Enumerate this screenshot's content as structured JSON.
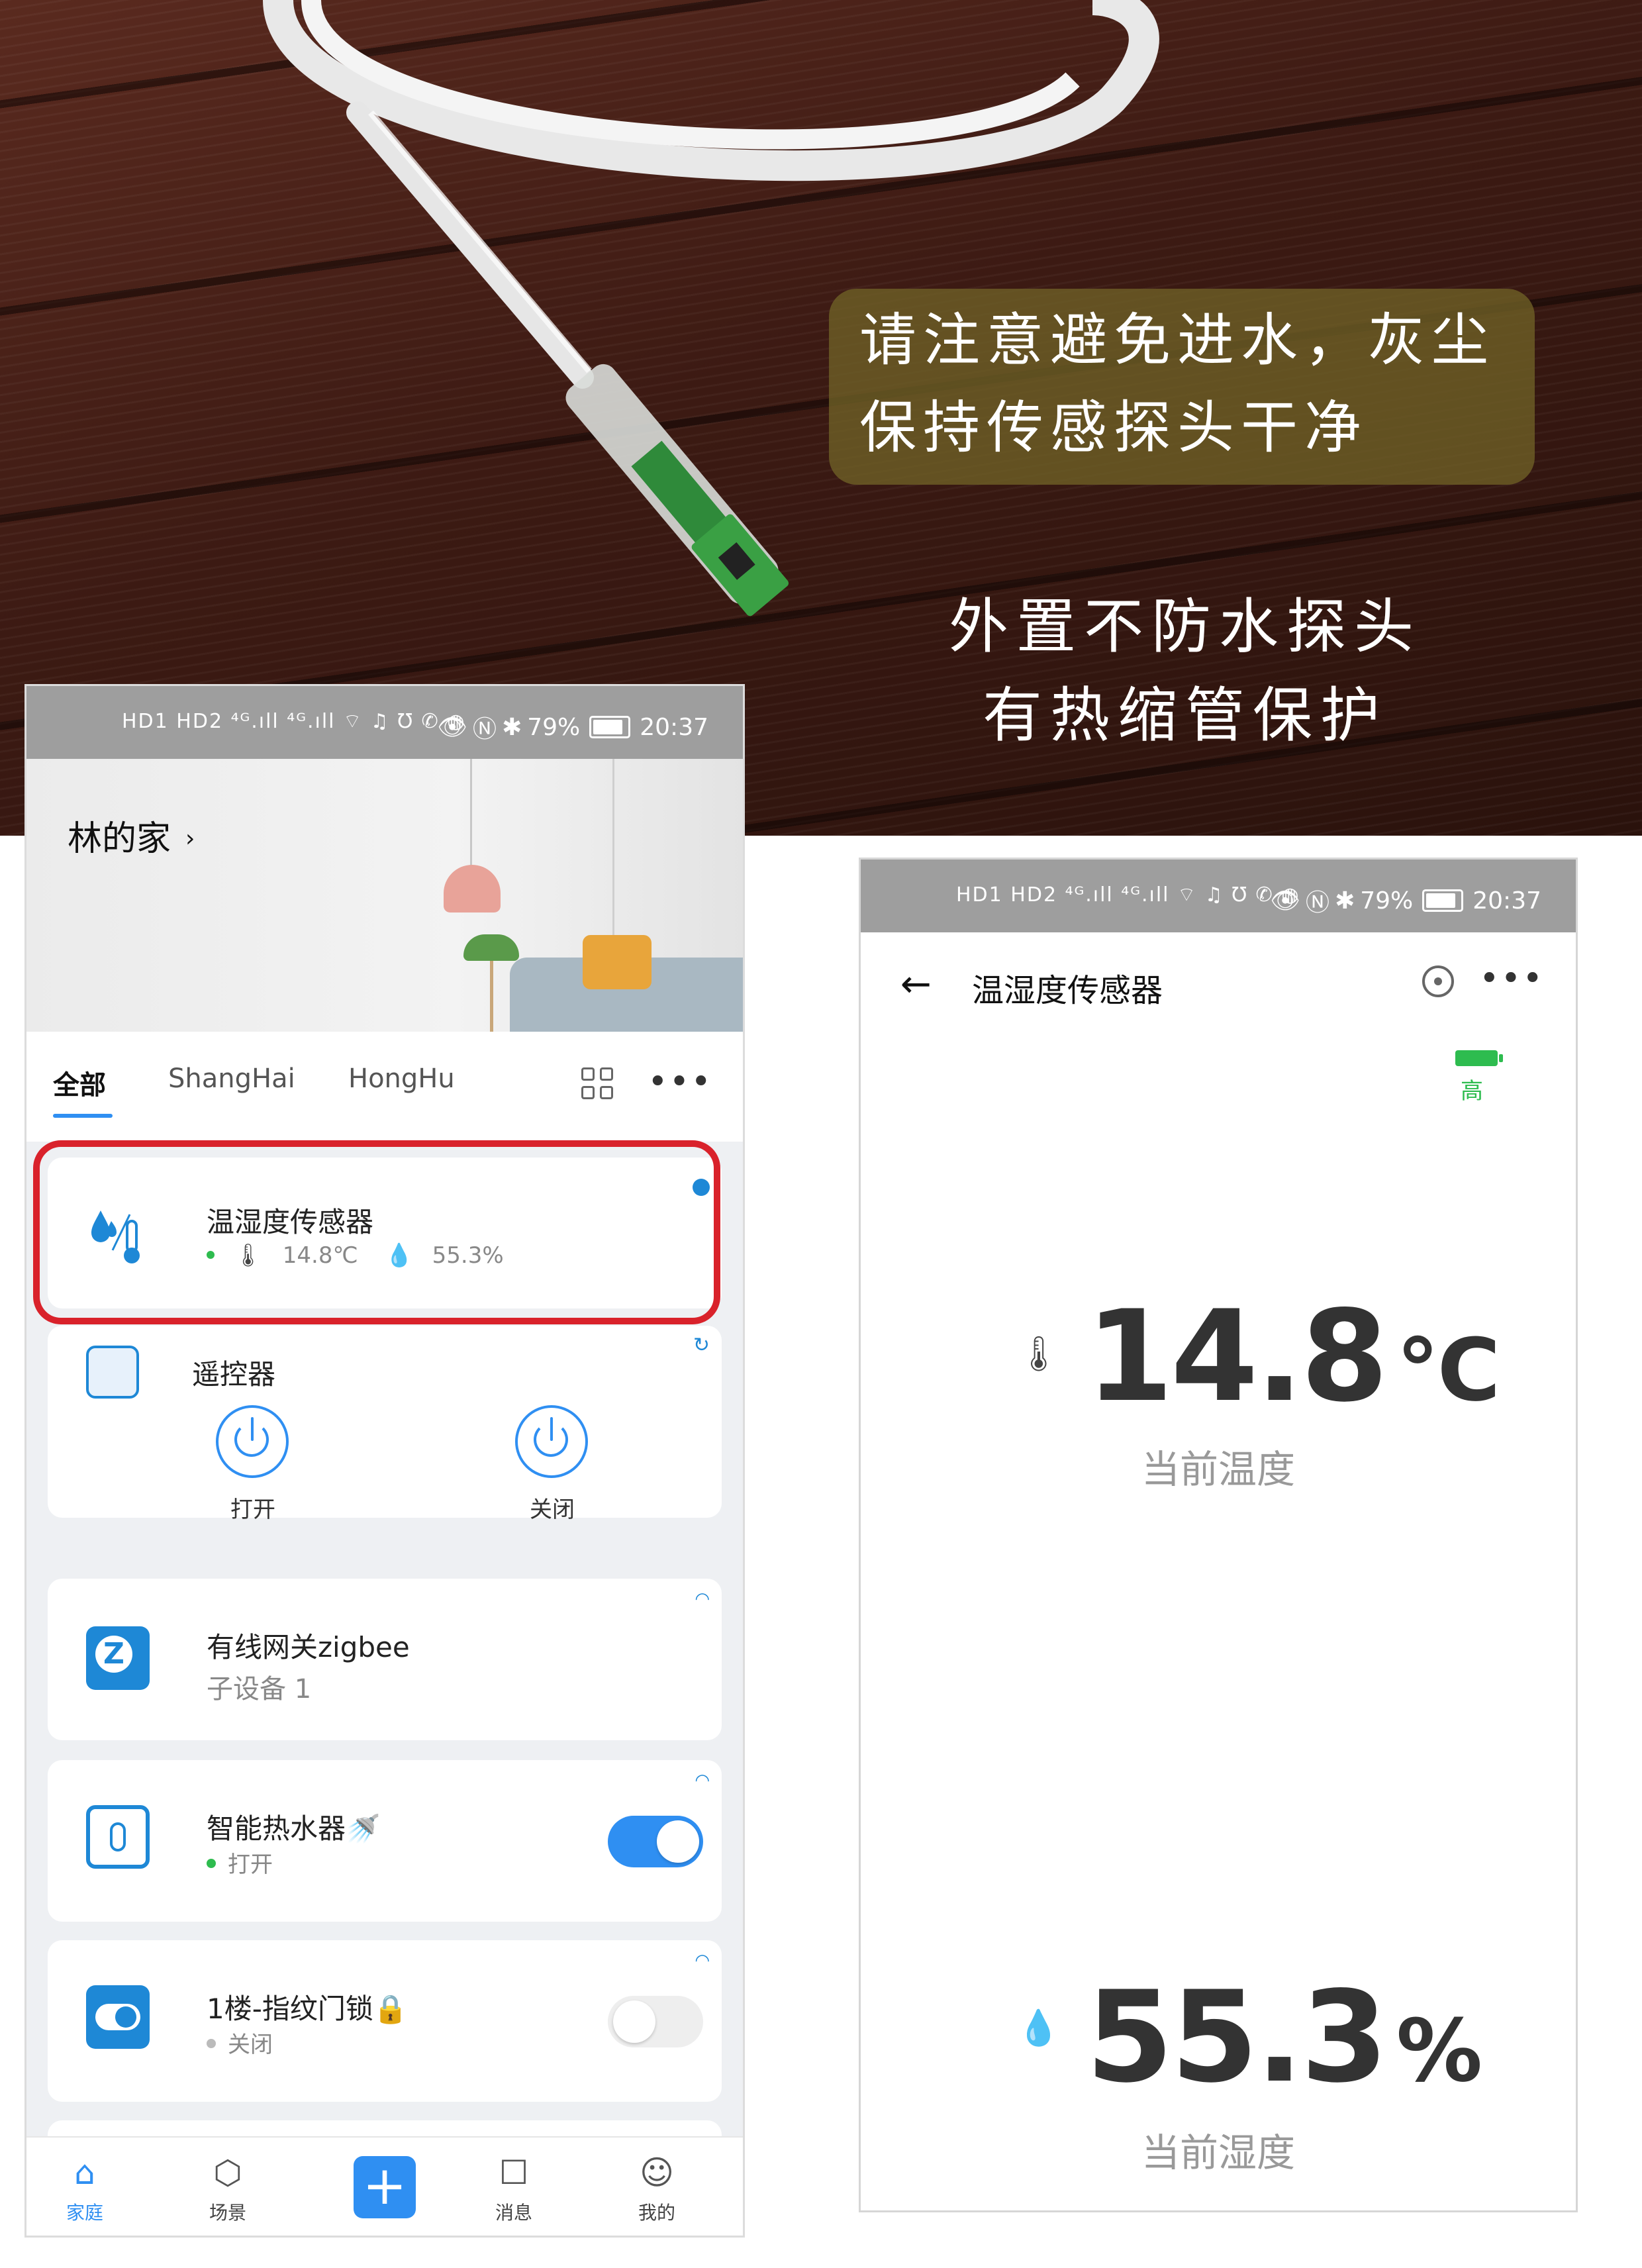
{
  "hero": {
    "callout_text": "请注意避免进水，灰尘\n保持传感探头干净",
    "caption": "外置不防水探头\n有热缩管保护"
  },
  "status_bar": {
    "left_icons": "HD1 HD2 ⁴ᴳ.ıll ⁴ᴳ.ıll ⌔ ♫ Ʊ ✆ ◍",
    "battery": "79%",
    "time": "20:37"
  },
  "home_screen": {
    "home_name": "林的家",
    "chevron": "›",
    "tabs": [
      {
        "label": "全部"
      },
      {
        "label": "ShangHai"
      },
      {
        "label": "HongHu"
      }
    ],
    "devices": [
      {
        "name": "温湿度传感器",
        "temp": "14.8℃",
        "humidity": "55.3%",
        "icon": "temp-humidity-icon"
      },
      {
        "name": "遥控器",
        "icon": "remote-icon",
        "buttons": [
          {
            "label": "打开"
          },
          {
            "label": "关闭"
          }
        ]
      },
      {
        "name": "有线网关zigbee",
        "sub": "子设备 1",
        "icon": "zigbee-gateway-icon"
      },
      {
        "name": "智能热水器🚿",
        "status": "打开",
        "on": true,
        "icon": "water-heater-icon"
      },
      {
        "name": "1楼-指纹门锁🔒",
        "status": "关闭",
        "on": false,
        "icon": "door-lock-icon"
      }
    ],
    "nav": [
      {
        "label": "家庭",
        "icon": "home-icon"
      },
      {
        "label": "场景",
        "icon": "scene-icon"
      },
      {
        "label": "",
        "icon": "add-icon"
      },
      {
        "label": "消息",
        "icon": "message-icon"
      },
      {
        "label": "我的",
        "icon": "profile-icon"
      }
    ]
  },
  "detail_screen": {
    "title": "温湿度传感器",
    "battery_level": "高",
    "temperature": {
      "value": "14.8",
      "unit": "℃",
      "label": "当前温度"
    },
    "humidity": {
      "value": "55.3",
      "unit": "%",
      "label": "当前湿度"
    }
  },
  "colors": {
    "accent": "#2f8ff2",
    "highlight": "#d9222b",
    "online": "#2ebc4f",
    "callout_bg": "#706226"
  }
}
